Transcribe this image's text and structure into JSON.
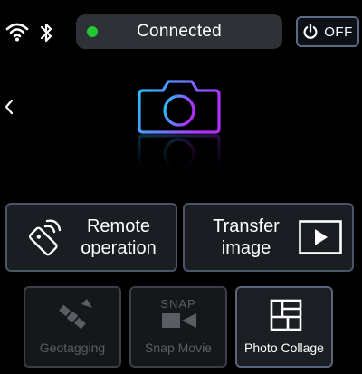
{
  "status": {
    "text": "Connected",
    "dot_color": "#22c832"
  },
  "power_button": {
    "label": "OFF"
  },
  "icons": {
    "wifi": "wifi-icon",
    "bluetooth": "bluetooth-icon",
    "back": "chevron-left-icon",
    "camera": "camera-icon",
    "remote": "remote-control-icon",
    "transfer": "transfer-image-icon",
    "geotagging": "satellite-icon",
    "snap_movie": "snap-movie-icon",
    "photo_collage": "photo-collage-icon"
  },
  "actions": {
    "remote": {
      "line1": "Remote",
      "line2": "operation"
    },
    "transfer": {
      "line1": "Transfer",
      "line2": "image"
    }
  },
  "features": {
    "geotagging": "Geotagging",
    "snap_movie": "Snap Movie",
    "snap_icon_text": "SNAP",
    "photo_collage": "Photo Collage"
  },
  "colors": {
    "accent_cyan": "#1ec8ff",
    "accent_purple": "#b030ff",
    "disabled": "#5a5e64"
  }
}
